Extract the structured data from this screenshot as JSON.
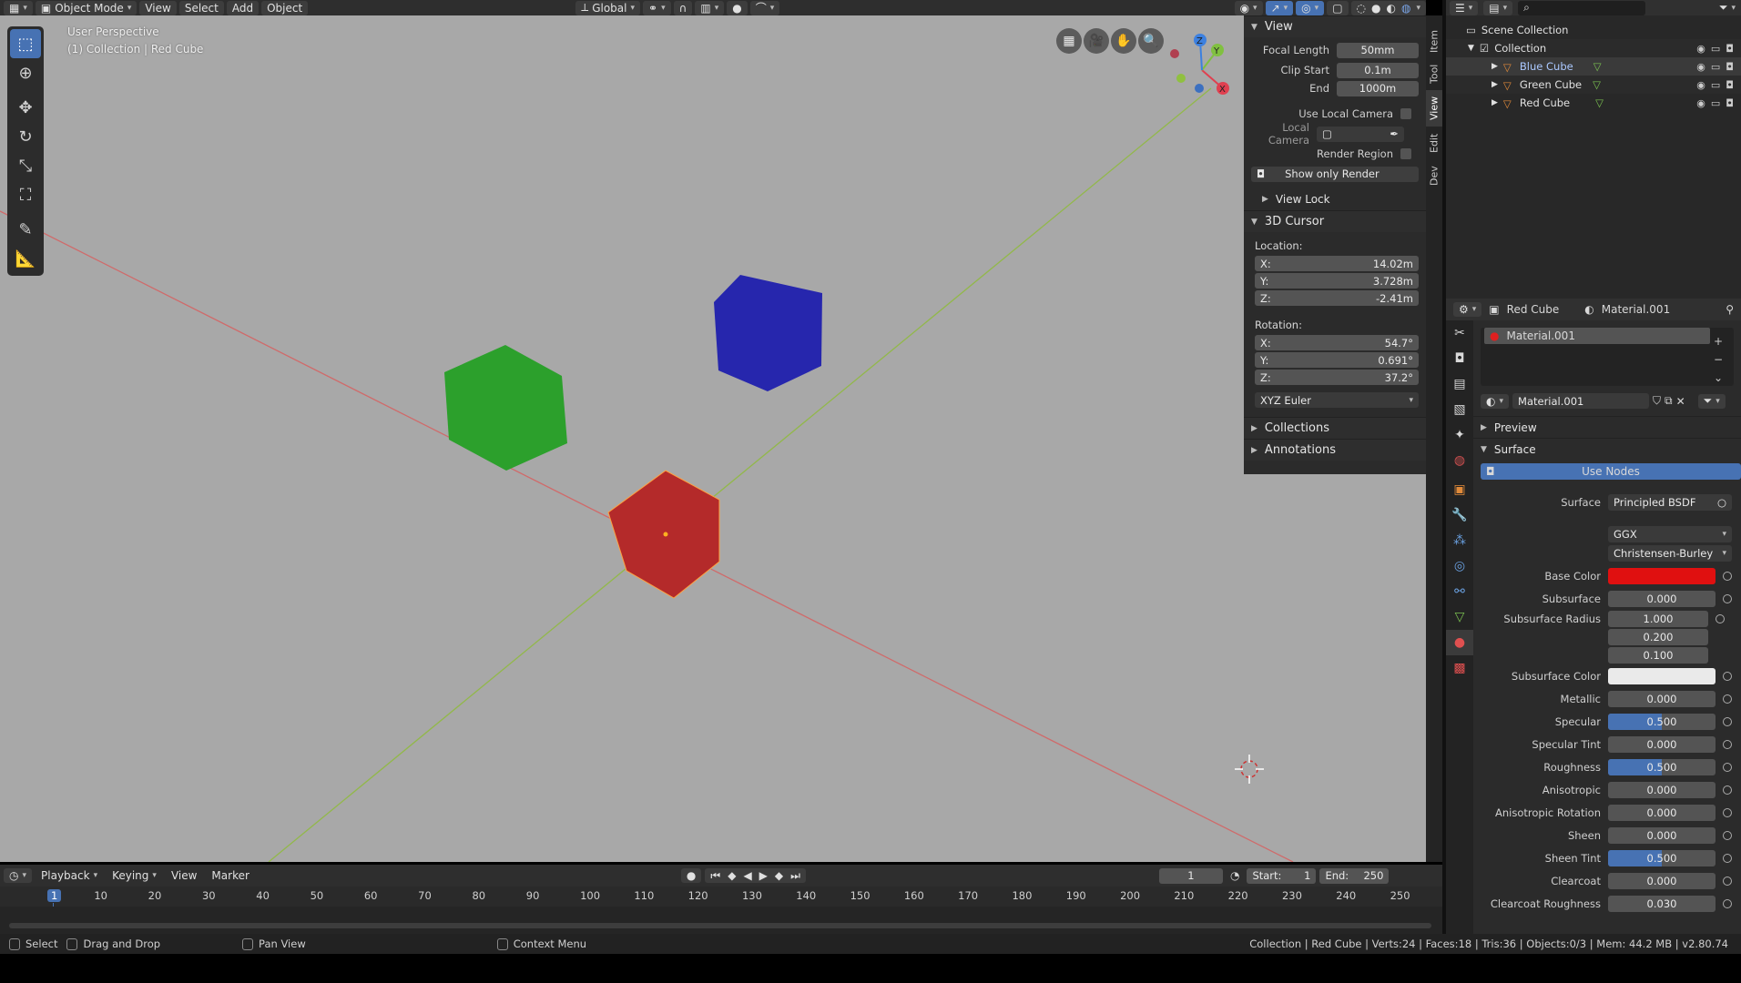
{
  "header": {
    "mode": "Object Mode",
    "menus": [
      "View",
      "Select",
      "Add",
      "Object"
    ],
    "orientation": "Global"
  },
  "viewport": {
    "perspective": "User Perspective",
    "collection_info": "(1) Collection | Red Cube"
  },
  "npanel": {
    "tabs": [
      "Item",
      "Tool",
      "View",
      "Edit",
      "Dev"
    ],
    "view_section": "View",
    "focal_length_label": "Focal Length",
    "focal_length": "50mm",
    "clip_start_label": "Clip Start",
    "clip_start": "0.1m",
    "end_label": "End",
    "end": "1000m",
    "use_local_camera": "Use Local Camera",
    "local_camera": "Local Camera",
    "render_region": "Render Region",
    "show_only_render": "Show only Render",
    "view_lock": "View Lock",
    "cursor_section": "3D Cursor",
    "location_label": "Location:",
    "loc_x": "14.02m",
    "loc_y": "3.728m",
    "loc_z": "-2.41m",
    "rotation_label": "Rotation:",
    "rot_x": "54.7°",
    "rot_y": "0.691°",
    "rot_z": "37.2°",
    "axis_x": "X:",
    "axis_y": "Y:",
    "axis_z": "Z:",
    "rotation_mode": "XYZ Euler",
    "collections": "Collections",
    "annotations": "Annotations"
  },
  "outliner": {
    "scene_collection": "Scene Collection",
    "collection": "Collection",
    "objects": [
      "Blue Cube",
      "Green Cube",
      "Red Cube"
    ]
  },
  "properties": {
    "object_name": "Red Cube",
    "material_name": "Material.001",
    "slot_name": "Material.001",
    "data_block": "Material.001",
    "preview": "Preview",
    "surface_section": "Surface",
    "use_nodes": "Use Nodes",
    "surface_label": "Surface",
    "surface_value": "Principled BSDF",
    "distribution": "GGX",
    "subsurface_method": "Christensen-Burley",
    "base_color_label": "Base Color",
    "base_color": "#e01010",
    "subsurface_label": "Subsurface",
    "subsurface": "0.000",
    "subsurface_radius_label": "Subsurface Radius",
    "subsurface_radius": [
      "1.000",
      "0.200",
      "0.100"
    ],
    "subsurface_color_label": "Subsurface Color",
    "metallic_label": "Metallic",
    "metallic": "0.000",
    "specular_label": "Specular",
    "specular": "0.500",
    "specular_tint_label": "Specular Tint",
    "specular_tint": "0.000",
    "roughness_label": "Roughness",
    "roughness": "0.500",
    "anisotropic_label": "Anisotropic",
    "anisotropic": "0.000",
    "anisotropic_rotation_label": "Anisotropic Rotation",
    "anisotropic_rotation": "0.000",
    "sheen_label": "Sheen",
    "sheen": "0.000",
    "sheen_tint_label": "Sheen Tint",
    "sheen_tint": "0.500",
    "clearcoat_label": "Clearcoat",
    "clearcoat": "0.000",
    "clearcoat_roughness_label": "Clearcoat Roughness",
    "clearcoat_roughness": "0.030"
  },
  "timeline": {
    "menus": [
      "Playback",
      "Keying",
      "View",
      "Marker"
    ],
    "current_frame": "1",
    "start_label": "Start:",
    "start": "1",
    "end_label": "End:",
    "end": "250",
    "ruler": [
      "1",
      "10",
      "20",
      "30",
      "40",
      "50",
      "60",
      "70",
      "80",
      "90",
      "100",
      "110",
      "120",
      "130",
      "140",
      "150",
      "160",
      "170",
      "180",
      "190",
      "200",
      "210",
      "220",
      "230",
      "240",
      "250"
    ]
  },
  "statusbar": {
    "select": "Select",
    "drag": "Drag and Drop",
    "pan": "Pan View",
    "context": "Context Menu",
    "info": "Collection | Red Cube | Verts:24 | Faces:18 | Tris:36 | Objects:0/3 | Mem: 44.2 MB | v2.80.74"
  }
}
